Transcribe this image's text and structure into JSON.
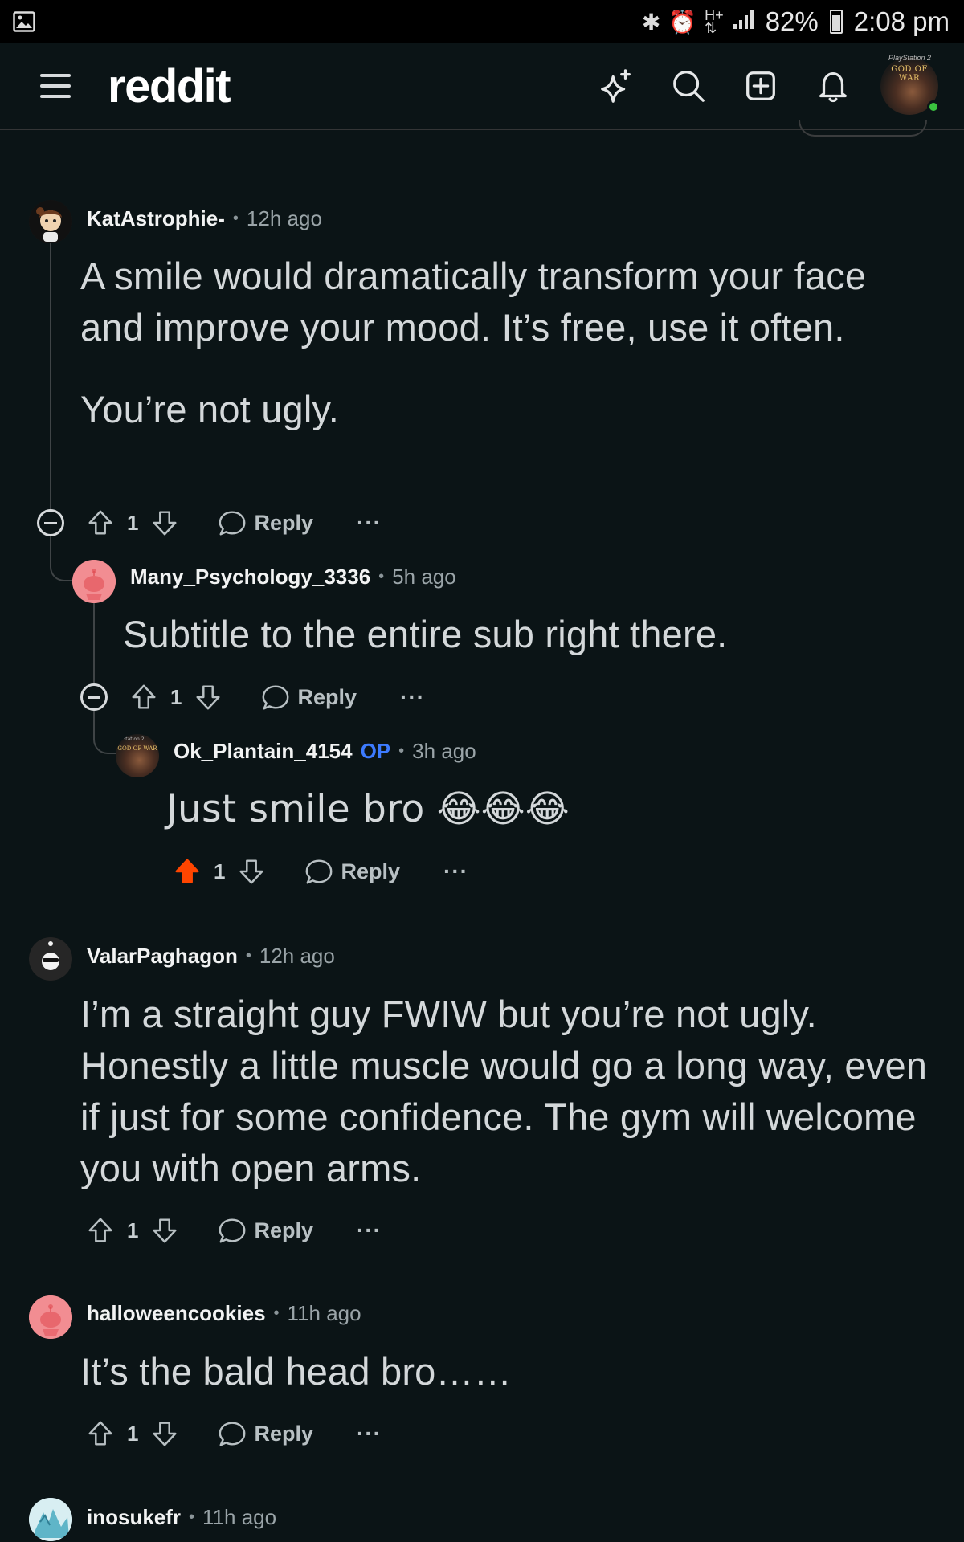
{
  "status_bar": {
    "battery": "82%",
    "time": "2:08 pm"
  },
  "header": {
    "logo": "reddit",
    "icons": [
      "sparkle-icon",
      "search-icon",
      "create-post-icon",
      "notifications-icon"
    ]
  },
  "comments": [
    {
      "author": "KatAstrophie-",
      "time": "12h ago",
      "paragraphs": [
        "A smile would dramatically transform your face and improve your mood. It’s free, use it often.",
        "You’re not ugly."
      ],
      "votes": "1",
      "reply_label": "Reply",
      "more_label": "···"
    },
    {
      "author": "Many_Psychology_3336",
      "time": "5h ago",
      "text": "Subtitle to the entire sub right there.",
      "votes": "1",
      "reply_label": "Reply",
      "more_label": "···"
    },
    {
      "author": "Ok_Plantain_4154",
      "badge": "OP",
      "time": "3h ago",
      "text": "Just smile bro 😂😂😂",
      "votes": "1",
      "upvoted": true,
      "reply_label": "Reply",
      "more_label": "···"
    },
    {
      "author": "ValarPaghagon",
      "time": "12h ago",
      "text": "I’m a straight guy FWIW but you’re not ugly. Honestly a little muscle would go a long way, even if just for some confidence. The gym will welcome you with open arms.",
      "votes": "1",
      "reply_label": "Reply",
      "more_label": "···"
    },
    {
      "author": "halloweencookies",
      "time": "11h ago",
      "text": "It’s the bald head bro……",
      "votes": "1",
      "reply_label": "Reply",
      "more_label": "···"
    },
    {
      "author": "inosukefr",
      "time": "11h ago"
    }
  ],
  "colors": {
    "background": "#0b1416",
    "upvote_active": "#ff4500",
    "op_badge": "#3d7bff",
    "online": "#3ac33f"
  }
}
